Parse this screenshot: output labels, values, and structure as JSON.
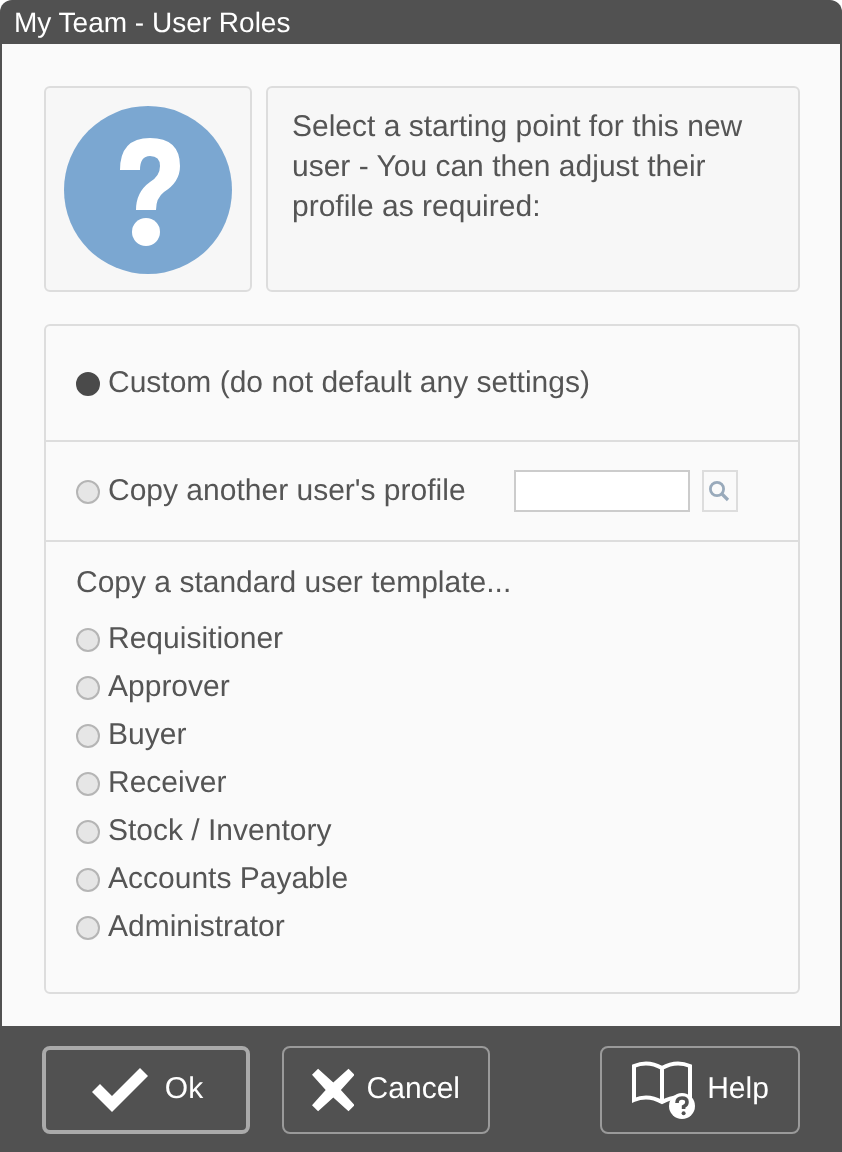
{
  "window": {
    "title": "My Team - User Roles"
  },
  "message": "Select a starting point for this new user - You can then adjust their profile as required:",
  "options": [
    {
      "kind": "plain",
      "label": "Custom (do not default any settings)",
      "selected": true
    },
    {
      "kind": "search",
      "label": "Copy another user's profile",
      "selected": false
    }
  ],
  "templates": {
    "heading": "Copy a standard user template...",
    "items": [
      {
        "label": "Requisitioner",
        "selected": false
      },
      {
        "label": "Approver",
        "selected": false
      },
      {
        "label": "Buyer",
        "selected": false
      },
      {
        "label": "Receiver",
        "selected": false
      },
      {
        "label": "Stock / Inventory",
        "selected": false
      },
      {
        "label": "Accounts Payable",
        "selected": false
      },
      {
        "label": "Administrator",
        "selected": false
      }
    ]
  },
  "buttons": [
    {
      "kind": "ok",
      "label": "Ok"
    },
    {
      "kind": "cancel",
      "label": "Cancel"
    },
    {
      "kind": "help",
      "label": "Help"
    }
  ]
}
